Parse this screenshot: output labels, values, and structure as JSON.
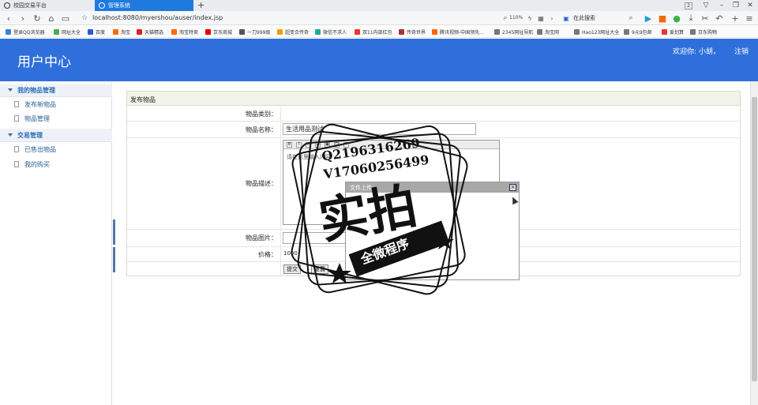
{
  "browser": {
    "tabs": [
      {
        "title": "校园交易平台",
        "active": false
      },
      {
        "title": "管理系统",
        "active": true
      }
    ],
    "window_badge": "2",
    "url": "localhost:8080/myershou/auser/index.jsp",
    "zoom": "110%",
    "search_placeholder": "在此搜索",
    "bookmarks": [
      {
        "label": "登录QQ浏览器",
        "color": "#3a80d8"
      },
      {
        "label": "网址大全",
        "color": "#4caf50"
      },
      {
        "label": "百度",
        "color": "#2a5bd7"
      },
      {
        "label": "淘宝",
        "color": "#ff6a00"
      },
      {
        "label": "天猫精选",
        "color": "#d22"
      },
      {
        "label": "淘宝特卖",
        "color": "#ff6a00"
      },
      {
        "label": "京东商城",
        "color": "#d00"
      },
      {
        "label": "一刀999级",
        "color": "#555"
      },
      {
        "label": "超变合传奇",
        "color": "#e8a000"
      },
      {
        "label": "微信不求人",
        "color": "#2a9"
      },
      {
        "label": "双11内部红包",
        "color": "#e33"
      },
      {
        "label": "传奇世界",
        "color": "#a33"
      },
      {
        "label": "腾讯视频-中国领先...",
        "color": "#f60"
      },
      {
        "label": "2345网址导航",
        "color": "#777"
      },
      {
        "label": "淘宝网",
        "color": "#777"
      },
      {
        "label": "Hao123网址大全",
        "color": "#777"
      },
      {
        "label": "9元9包邮",
        "color": "#777"
      },
      {
        "label": "爱划算",
        "color": "#e33"
      },
      {
        "label": "京东购物",
        "color": "#777"
      }
    ]
  },
  "header": {
    "title": "用户中心",
    "welcome": "欢迎你: 小胡，",
    "logout": "注销"
  },
  "sidebar": {
    "groups": [
      {
        "label": "我的物品管理",
        "items": [
          "发布新物品",
          "物品管理"
        ]
      },
      {
        "label": "交易管理",
        "items": [
          "已售出物品",
          "我的购买"
        ]
      }
    ]
  },
  "form": {
    "title": "发布物品",
    "category_label": "物品类别：",
    "name_label": "物品名称：",
    "name_value": "生活用品测试",
    "desc_label": "物品描述：",
    "desc_placeholder": "请在这里输入内容",
    "image_label": "物品图片：",
    "price_label": "价格：",
    "price_value": "1000",
    "submit": "提交",
    "reset": "重置"
  },
  "dialog": {
    "title": "文件上传",
    "close": "×"
  },
  "watermark": {
    "line1": "Q2196316269",
    "line2": "V17060256499",
    "big": "实拍",
    "band": "全微程序"
  }
}
